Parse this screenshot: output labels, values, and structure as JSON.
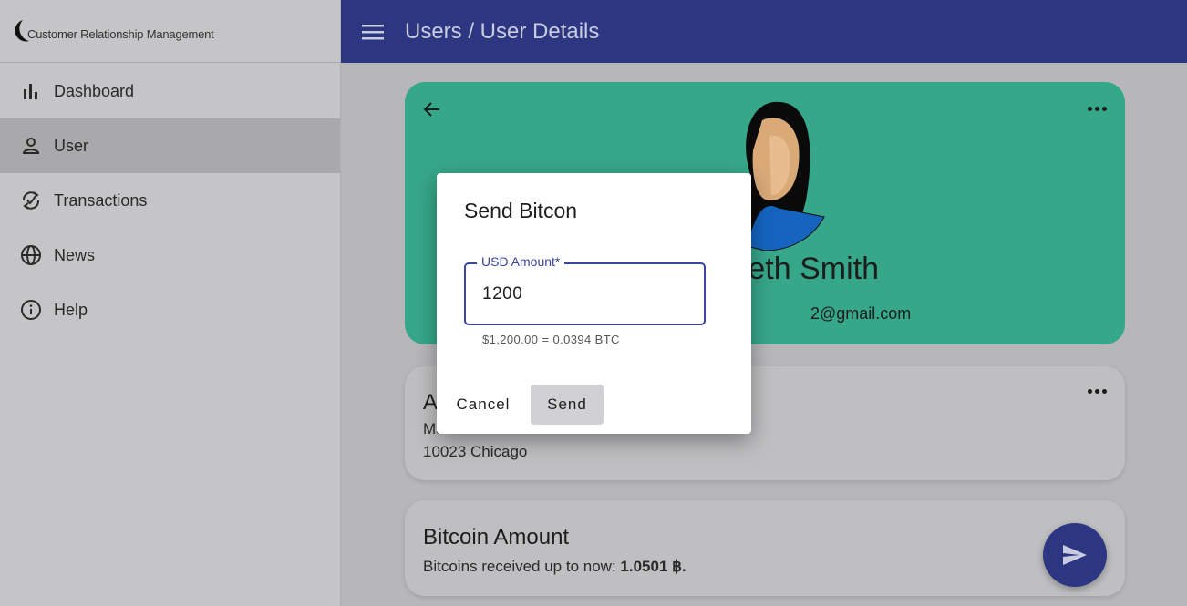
{
  "app": {
    "logo_text": "Customer Relationship Management"
  },
  "sidebar": {
    "items": [
      {
        "label": "Dashboard",
        "icon": "bar-chart-icon"
      },
      {
        "label": "User",
        "icon": "person-icon",
        "active": true
      },
      {
        "label": "Transactions",
        "icon": "sync-check-icon"
      },
      {
        "label": "News",
        "icon": "globe-icon"
      },
      {
        "label": "Help",
        "icon": "info-icon"
      }
    ]
  },
  "header": {
    "title": "Users / User Details"
  },
  "profile": {
    "name_visible": "eth Smith",
    "email_visible": "2@gmail.com"
  },
  "address": {
    "title_visible": "A",
    "line1_visible": "Main Street 12",
    "line2": "10023 Chicago"
  },
  "bitcoin": {
    "title": "Bitcoin Amount",
    "text_prefix": "Bitcoins received up to now: ",
    "amount": "1.0501 ฿."
  },
  "dialog": {
    "title": "Send Bitcon",
    "field_label": "USD Amount*",
    "field_value": "1200",
    "helper": "$1,200.00 = 0.0394 BTC",
    "cancel_label": "Cancel",
    "send_label": "Send"
  },
  "colors": {
    "topbar": "#2d3680",
    "profile_card": "#37a78a",
    "fab": "#2d3680",
    "accent": "#3a45a0"
  }
}
